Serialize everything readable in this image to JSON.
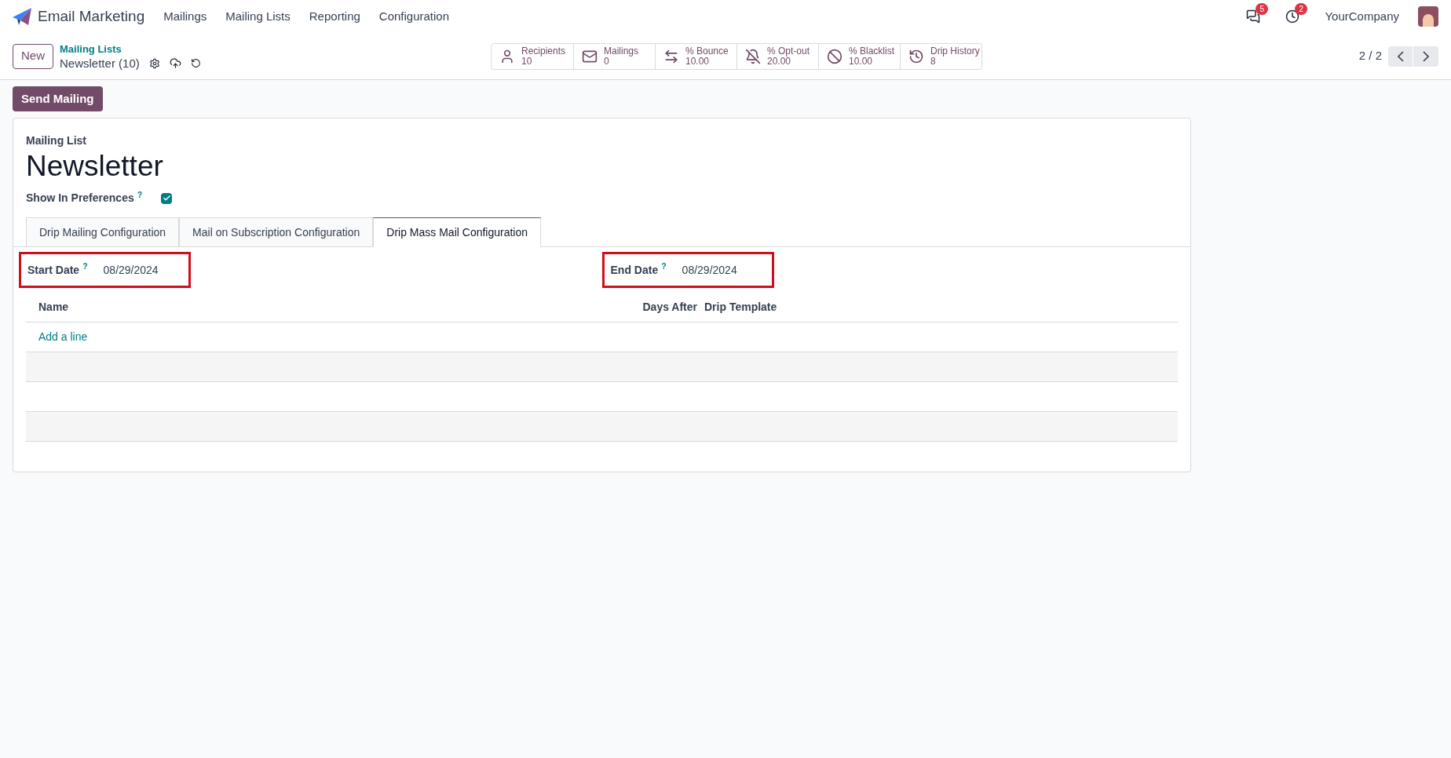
{
  "navbar": {
    "app_name": "Email Marketing",
    "menu": [
      "Mailings",
      "Mailing Lists",
      "Reporting",
      "Configuration"
    ],
    "messages_badge": "5",
    "activities_badge": "2",
    "company": "YourCompany"
  },
  "control_panel": {
    "new_button": "New",
    "breadcrumb": "Mailing Lists",
    "record": "Newsletter (10)",
    "pager": "2 / 2",
    "stats": [
      {
        "kind": "recipients",
        "label": "Recipients",
        "value": "10"
      },
      {
        "kind": "mailings",
        "label": "Mailings",
        "value": "0"
      },
      {
        "kind": "bounce",
        "label": "% Bounce",
        "value": "10.00"
      },
      {
        "kind": "optout",
        "label": "% Opt-out",
        "value": "20.00"
      },
      {
        "kind": "blacklist",
        "label": "% Blacklist",
        "value": "10.00"
      },
      {
        "kind": "history",
        "label": "Drip History",
        "value": "8"
      }
    ]
  },
  "send_button": "Send Mailing",
  "form": {
    "label": "Mailing List",
    "title": "Newsletter",
    "show_in_preferences": {
      "label": "Show In Preferences",
      "help": "?",
      "checked": true
    },
    "tabs": [
      {
        "label": "Drip Mailing Configuration",
        "selected": false
      },
      {
        "label": "Mail on Subscription Configuration",
        "selected": false
      },
      {
        "label": "Drip Mass Mail Configuration",
        "selected": true
      }
    ],
    "fields": [
      {
        "label": "Start Date",
        "help": "?",
        "value": "08/29/2024",
        "highlighted": true
      },
      {
        "label": "End Date",
        "help": "?",
        "value": "08/29/2024",
        "highlighted": true
      }
    ],
    "table": {
      "columns": [
        "Name",
        "Days After",
        "Drip Template"
      ],
      "add_line": "Add a line"
    }
  }
}
